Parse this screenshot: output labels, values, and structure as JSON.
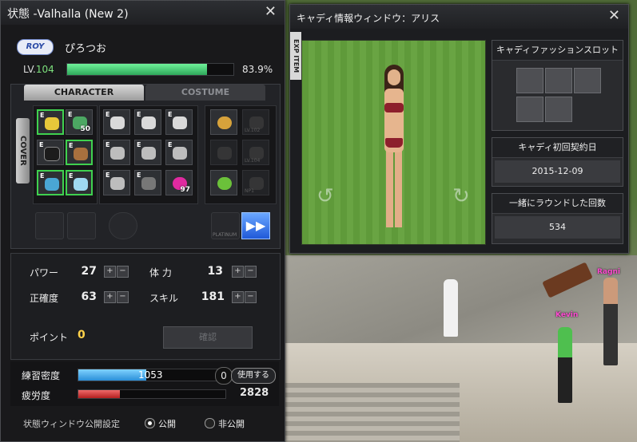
{
  "status_window": {
    "title": "状態 -Valhalla (New 2)",
    "close": "✕",
    "rank_badge": "ROY",
    "nickname": "ぴろつお",
    "level_label": "LV.",
    "level_value": "104",
    "xp_fraction": 0.839,
    "xp_percent": "83.9%",
    "tabs": {
      "character": "CHARACTER",
      "costume": "COSTUME"
    },
    "cover_label": "COVER",
    "slot_counts": {
      "slot_b": "50",
      "slot_pink": "97"
    },
    "slot_small_labels": {
      "lv102": "LV.102",
      "lv104": "LV.104",
      "np1": "NP1",
      "platinum": "PLATINUM"
    },
    "stats": {
      "power_label": "パワー",
      "power_value": "27",
      "stamina_label": "体 力",
      "stamina_value": "13",
      "accuracy_label": "正確度",
      "accuracy_value": "63",
      "skill_label": "スキル",
      "skill_value": "181",
      "points_label": "ポイント",
      "points_value": "0",
      "confirm_label": "確認"
    },
    "practice": {
      "label": "練習密度",
      "value": "1053",
      "fill_fraction": 0.46,
      "pill": "0",
      "use_button": "使用する"
    },
    "fatigue": {
      "label": "疲労度",
      "value": "2828",
      "fill_fraction": 0.28
    },
    "visibility": {
      "label": "状態ウィンドウ公開設定",
      "public": "公開",
      "private": "非公開"
    }
  },
  "caddie_window": {
    "title": "キャディ情報ウィンドウ：アリス",
    "close": "✕",
    "exp_tab": "EXP ITEM",
    "fashion_slot_title": "キャディファッションスロット",
    "contract_date_title": "キャディ初回契約日",
    "contract_date_value": "2015-12-09",
    "rounds_title": "一緒にラウンドした回数",
    "rounds_value": "534",
    "rotate_left": "↺",
    "rotate_right": "↻"
  },
  "scene": {
    "npc_names": [
      "Ragni",
      "Kevin"
    ]
  },
  "colors": {
    "xp_bar": "#3fcf6b",
    "practice_bar": "#4fb7ff",
    "fatigue_bar": "#e04444",
    "npc_name": "#ff4bd2",
    "points_value": "#ffd24a"
  }
}
